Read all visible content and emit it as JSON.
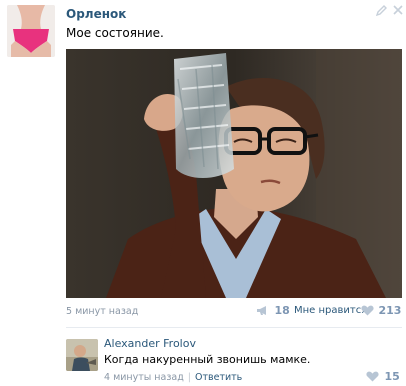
{
  "post": {
    "author": "Орленок",
    "text": "Мое состояние.",
    "time": "5 минут назад",
    "share_count": "18",
    "like_label": "Мне нравится",
    "like_count": "213"
  },
  "comment": {
    "author": "Alexander Frolov",
    "text": "Когда накуренный звонишь мамке.",
    "time": "4 минуты назад",
    "reply_label": "Ответить",
    "like_count": "15"
  },
  "colors": {
    "link": "#2b587a",
    "meta": "#8a97a6",
    "like": "#7d96b3"
  },
  "icons": {
    "edit": "pencil-icon",
    "delete": "close-icon",
    "share": "megaphone-icon",
    "like": "heart-icon"
  }
}
